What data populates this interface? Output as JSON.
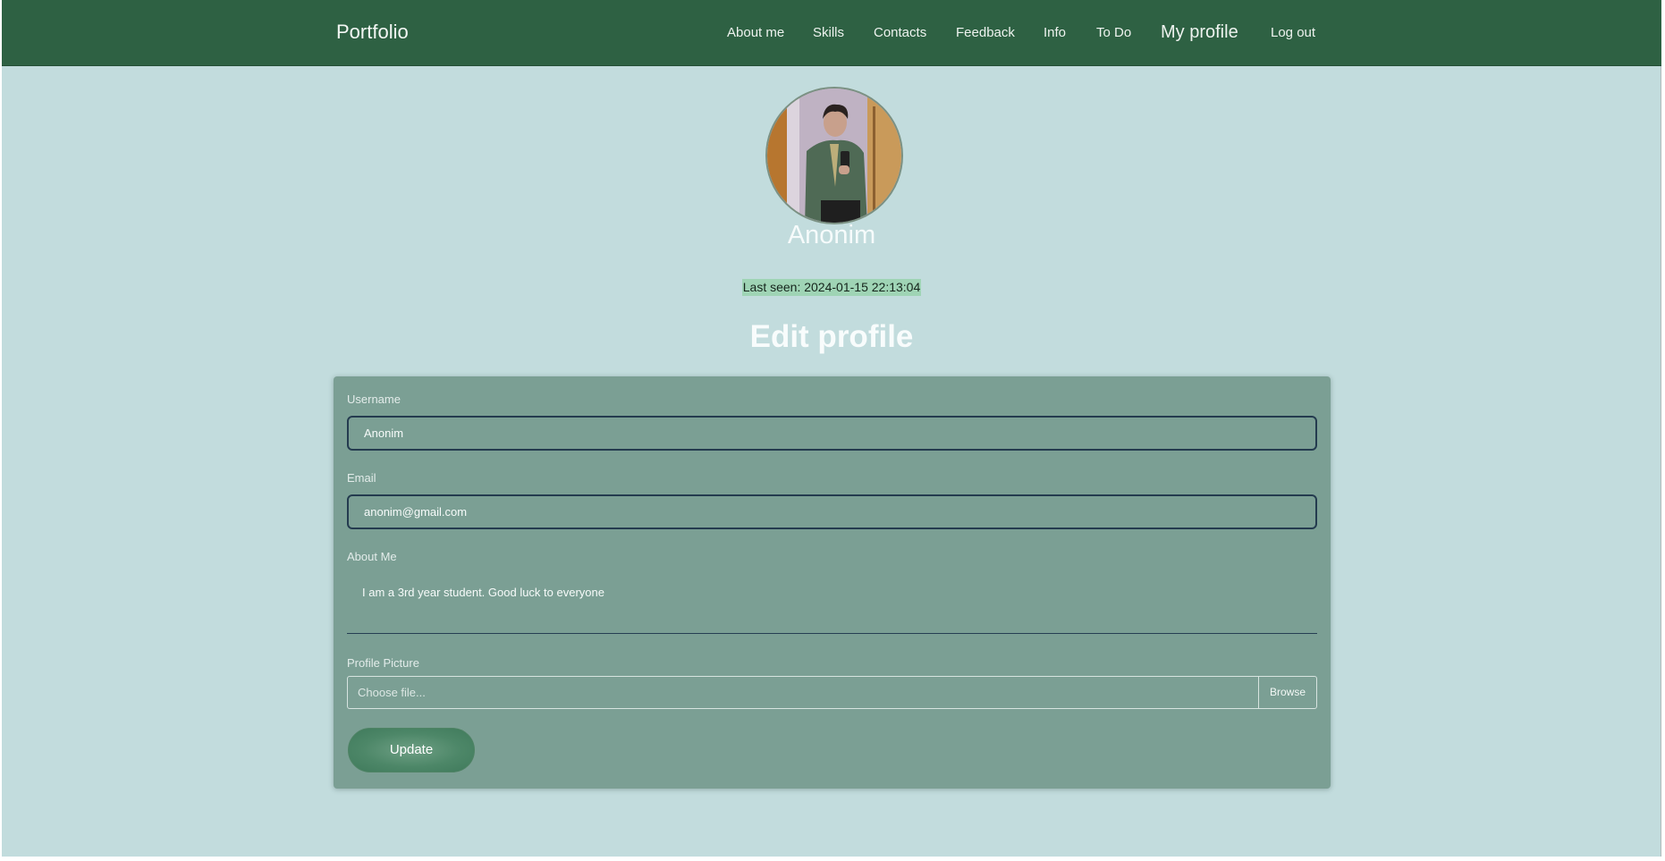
{
  "navbar": {
    "brand": "Portfolio",
    "links": [
      {
        "label": "About me"
      },
      {
        "label": "Skills"
      },
      {
        "label": "Contacts"
      },
      {
        "label": "Feedback"
      },
      {
        "label": "Info"
      },
      {
        "label": "To Do"
      },
      {
        "label": "My profile"
      },
      {
        "label": "Log out"
      }
    ]
  },
  "profile": {
    "avatar_alt": "profile-photo",
    "name": "Anonim",
    "last_seen": "Last seen: 2024-01-15 22:13:04"
  },
  "form": {
    "title": "Edit profile",
    "username_label": "Username",
    "username_value": "Anonim",
    "email_label": "Email",
    "email_value": "anonim@gmail.com",
    "about_label": "About Me",
    "about_value": "I am a 3rd year student. Good luck to everyone",
    "picture_label": "Profile Picture",
    "file_placeholder": "Choose file...",
    "browse_label": "Browse",
    "update_label": "Update"
  },
  "colors": {
    "navbar": "#2e6143",
    "background": "#c2dcdd",
    "card": "#7b9f94",
    "button": "#4d8768",
    "highlight": "#9fd4b5"
  }
}
